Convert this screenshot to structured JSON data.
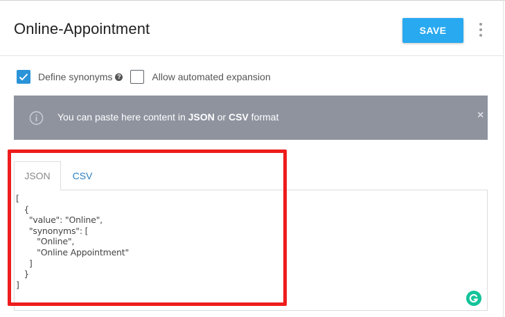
{
  "header": {
    "title": "Online-Appointment",
    "save_label": "SAVE",
    "more_icon": "more-vertical-icon"
  },
  "options": {
    "define_synonyms": {
      "label": "Define synonyms",
      "checked": true,
      "help_icon": "help-icon"
    },
    "allow_expansion": {
      "label": "Allow automated expansion",
      "checked": false
    }
  },
  "banner": {
    "icon": "info-icon",
    "text_pre": "You can paste here content in ",
    "format1": "JSON",
    "text_mid": " or ",
    "format2": "CSV",
    "text_post": " format",
    "close_icon": "close-icon",
    "close_glyph": "×"
  },
  "tabs": [
    {
      "label": "JSON",
      "active": true
    },
    {
      "label": "CSV",
      "active": false
    }
  ],
  "editor": {
    "content": "[\n   {\n     \"value\": \"Online\",\n     \"synonyms\": [\n        \"Online\",\n        \"Online Appointment\"\n     ]\n   }\n]"
  },
  "colors": {
    "accent": "#29a9f0",
    "checkbox": "#2b93d8",
    "banner": "#8e939e",
    "highlight": "#ee1c1c",
    "grammarly": "#15c39a"
  }
}
